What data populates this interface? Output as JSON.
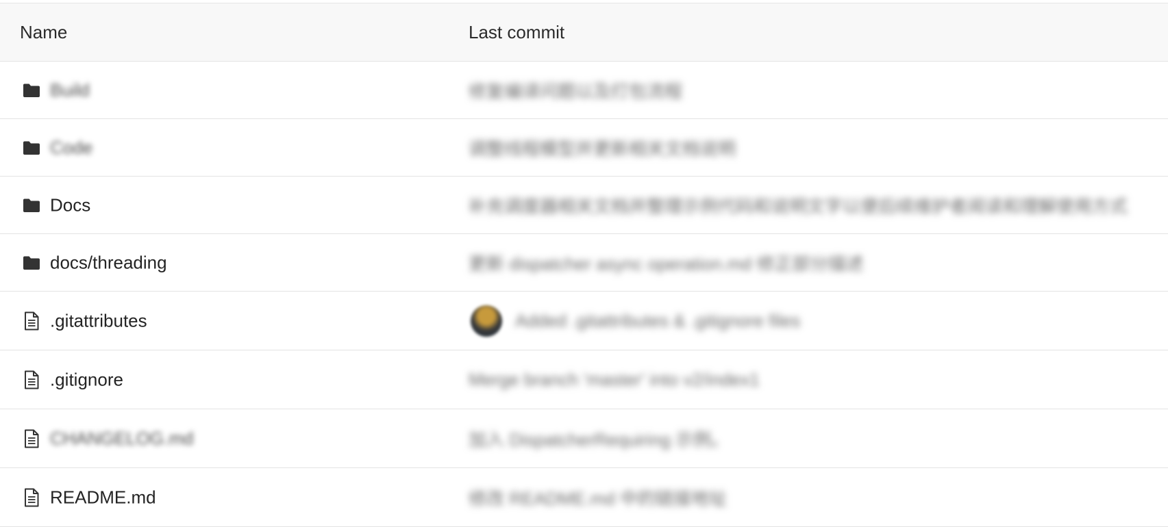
{
  "header": {
    "name_label": "Name",
    "commit_label": "Last commit"
  },
  "rows": [
    {
      "type": "folder",
      "name": "Build",
      "commit": "修复编译问题以及打包流程",
      "blurred_name": true
    },
    {
      "type": "folder",
      "name": "Code",
      "commit": "调整线程模型并更新相关文档说明",
      "blurred_name": true
    },
    {
      "type": "folder",
      "name": "Docs",
      "commit": "补充调度器相关文档并整理示例代码和说明文字以便后续维护者阅读和理解使用方式",
      "blurred_name": false
    },
    {
      "type": "folder",
      "name": "docs/threading",
      "commit": "更新 dispatcher async operation.md 修正部分描述",
      "blurred_name": false
    },
    {
      "type": "file",
      "name": ".gitattributes",
      "commit": "Added .gitattributes & .gitignore files",
      "blurred_name": false,
      "avatar": true
    },
    {
      "type": "file",
      "name": ".gitignore",
      "commit": "Merge branch 'master' into v2/index1",
      "blurred_name": false
    },
    {
      "type": "file",
      "name": "CHANGELOG.md",
      "commit": "加入 DispatcherRequiring 示例。",
      "blurred_name": true
    },
    {
      "type": "file",
      "name": "README.md",
      "commit": "修改 README.md 中的链接地址",
      "blurred_name": false
    }
  ],
  "icons": {
    "folder": "folder-icon",
    "file": "file-icon"
  },
  "colors": {
    "header_bg": "#f8f8f8",
    "border": "#e3e3e3",
    "icon": "#333333"
  }
}
